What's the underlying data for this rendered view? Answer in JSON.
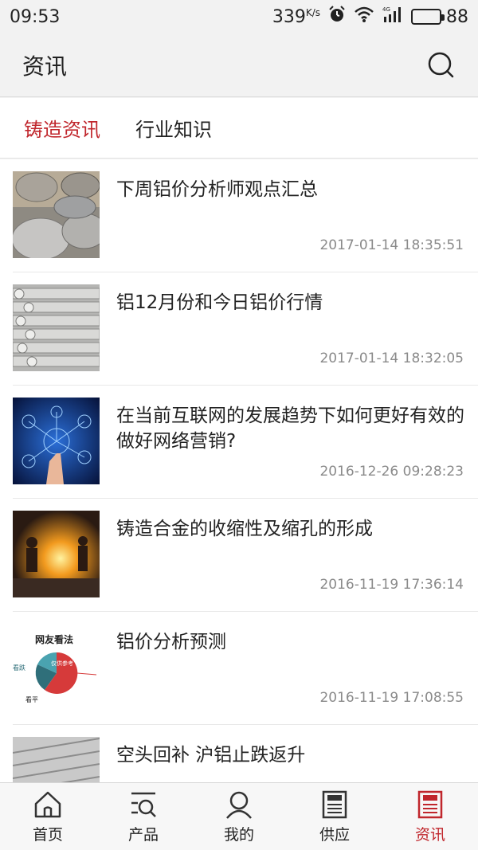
{
  "status_bar": {
    "time": "09:53",
    "speed": "339",
    "speed_unit": "K/s",
    "battery": "88",
    "network": "4G"
  },
  "header": {
    "title": "资讯"
  },
  "tabs": [
    {
      "label": "铸造资讯",
      "active": true
    },
    {
      "label": "行业知识",
      "active": false
    }
  ],
  "news": [
    {
      "title": "下周铝价分析师观点汇总",
      "date": "2017-01-14 18:35:51"
    },
    {
      "title": "铝12月份和今日铝价行情",
      "date": "2017-01-14 18:32:05"
    },
    {
      "title": "在当前互联网的发展趋势下如何更好有效的做好网络营销?",
      "date": "2016-12-26 09:28:23"
    },
    {
      "title": "铸造合金的收缩性及缩孔的形成",
      "date": "2016-11-19 17:36:14"
    },
    {
      "title": "铝价分析预测",
      "date": "2016-11-19 17:08:55"
    },
    {
      "title": "空头回补 沪铝止跌返升",
      "date": ""
    }
  ],
  "pie_thumb": {
    "heading": "网友看法",
    "label_left": "看跌",
    "label_center": "仅供参考",
    "label_bottom": "看平"
  },
  "nav": [
    {
      "label": "首页",
      "icon": "home-icon"
    },
    {
      "label": "产品",
      "icon": "product-search-icon"
    },
    {
      "label": "我的",
      "icon": "user-icon"
    },
    {
      "label": "供应",
      "icon": "supply-doc-icon"
    },
    {
      "label": "资讯",
      "icon": "news-doc-icon",
      "active": true
    }
  ],
  "colors": {
    "accent": "#c0262c",
    "background": "#f2f2f2"
  }
}
